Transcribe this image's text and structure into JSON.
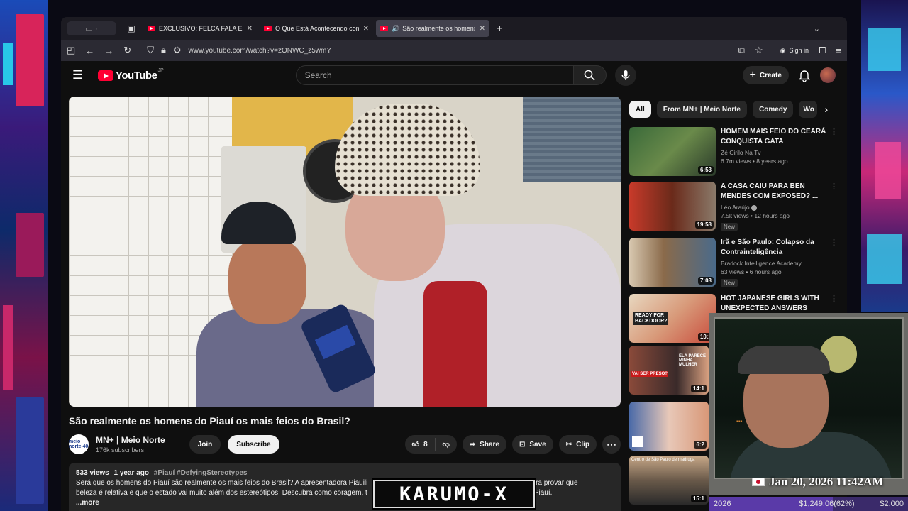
{
  "browser": {
    "tabs": [
      {
        "label": "EXCLUSIVO: FELCA FALA EM AI",
        "active": false
      },
      {
        "label": "O Que Está Acontecendo com a",
        "active": false
      },
      {
        "label": "São realmente os homens d",
        "active": true
      }
    ],
    "url": "www.youtube.com/watch?v=zONWC_z5wmY",
    "sign_in": "Sign in"
  },
  "masthead": {
    "logo_text": "YouTube",
    "region": "JP",
    "search_placeholder": "Search",
    "create_label": "Create"
  },
  "video": {
    "title": "São realmente os homens do Piauí os mais feios do Brasil?",
    "channel": {
      "name": "MN+ | Meio Norte",
      "subscribers": "176k subscribers",
      "avatar_text": "meio norte 40"
    },
    "join_label": "Join",
    "subscribe_label": "Subscribe",
    "likes": "8",
    "share_label": "Share",
    "save_label": "Save",
    "clip_label": "Clip",
    "description": {
      "views": "533 views",
      "age": "1 year ago",
      "tags": "#Piauí #DefyingStereotypes",
      "line1": "Será que os homens do Piauí são realmente os mais feios do Brasil? A apresentadora Piauili",
      "line1_end": "quienses para provar que",
      "line2": "beleza é relativa e que o estado vai muito além dos estereótipos. Descubra como coragem, t",
      "line2_end": "homens do Piauí.",
      "more": "...more"
    }
  },
  "sidebar": {
    "chips": [
      "All",
      "From MN+ | Meio Norte",
      "Comedy",
      "Wo"
    ],
    "recommendations": [
      {
        "title": "HOMEM MAIS FEIO DO CEARÁ CONQUISTA GATA",
        "channel": "Zé Cirilo Na Tv",
        "stats": "6.7m views • 8 years ago",
        "duration": "6:53",
        "badge": "",
        "verified": false
      },
      {
        "title": "A CASA CAIU PARA BEN MENDES COM EXPOSED? ...",
        "channel": "Léo Araújo",
        "stats": "7.5k views • 12 hours ago",
        "duration": "19:58",
        "badge": "New",
        "verified": true
      },
      {
        "title": "Irã e São Paulo: Colapso da Contrainteligência",
        "channel": "Bradock Intelligence Academy",
        "stats": "63 views • 6 hours ago",
        "duration": "7:03",
        "badge": "New",
        "verified": false
      },
      {
        "title": "HOT JAPANESE GIRLS WITH UNEXPECTED ANSWERS",
        "channel": "",
        "stats": "",
        "duration": "10:2",
        "badge": "",
        "verified": false
      },
      {
        "title": "",
        "channel": "",
        "stats": "",
        "duration": "14:1",
        "badge": "",
        "verified": false
      },
      {
        "title": "",
        "channel": "",
        "stats": "",
        "duration": "6:2",
        "badge": "",
        "verified": false
      },
      {
        "title": "",
        "channel": "",
        "stats": "",
        "duration": "15:1",
        "badge": "",
        "verified": false
      }
    ],
    "thumb_texts": {
      "ready": "READY FOR BACKDOOR?",
      "vai_ser_preso": "VAI SER PRESO?",
      "parece": "ELA PARECE MINHA MULHER",
      "centro": "Centro de São Paulo de madruga"
    }
  },
  "overlay": {
    "date": "Jan 20, 2026 11:42AM",
    "goal_year": "2026",
    "goal_amount": "$1,249.06(62%)",
    "goal_fraction": 0.62,
    "goal_target": "$2,000",
    "logo": "KARUMO-X"
  },
  "colors": {
    "accent": "#ff0033",
    "page_bg": "#0f0f0f",
    "chip_bg": "#272727"
  }
}
